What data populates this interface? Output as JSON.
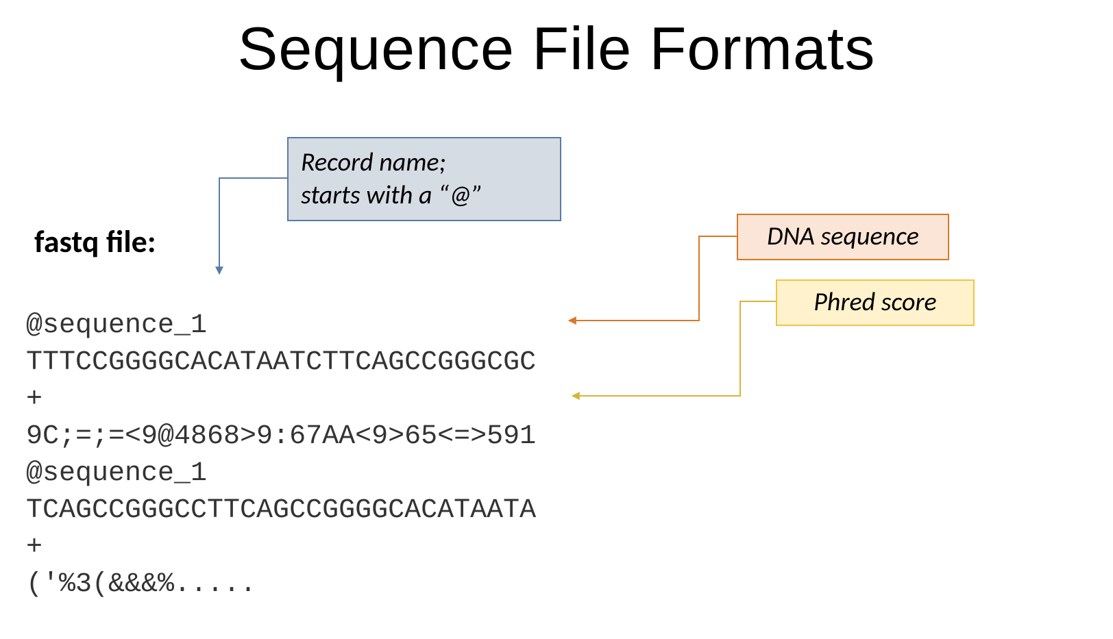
{
  "title": "Sequence File Formats",
  "file_label": "fastq file:",
  "callouts": {
    "record": "Record name;\nstarts with a “@”",
    "dna": "DNA sequence",
    "phred": "Phred score"
  },
  "code": {
    "line1": "@sequence_1",
    "line2": "TTTCCGGGGCACATAATCTTCAGCCGGGCGC",
    "line3": "+",
    "line4": "9C;=;=<9@4868>9:67AA<9>65<=>591",
    "line5": "@sequence_1",
    "line6": "TCAGCCGGGCCTTCAGCCGGGGCACATAATA",
    "line7": "+",
    "line8": "('%3(&&&%....."
  },
  "connector_colors": {
    "record": "#5b7aa8",
    "dna": "#d97828",
    "phred": "#d9b43a"
  }
}
